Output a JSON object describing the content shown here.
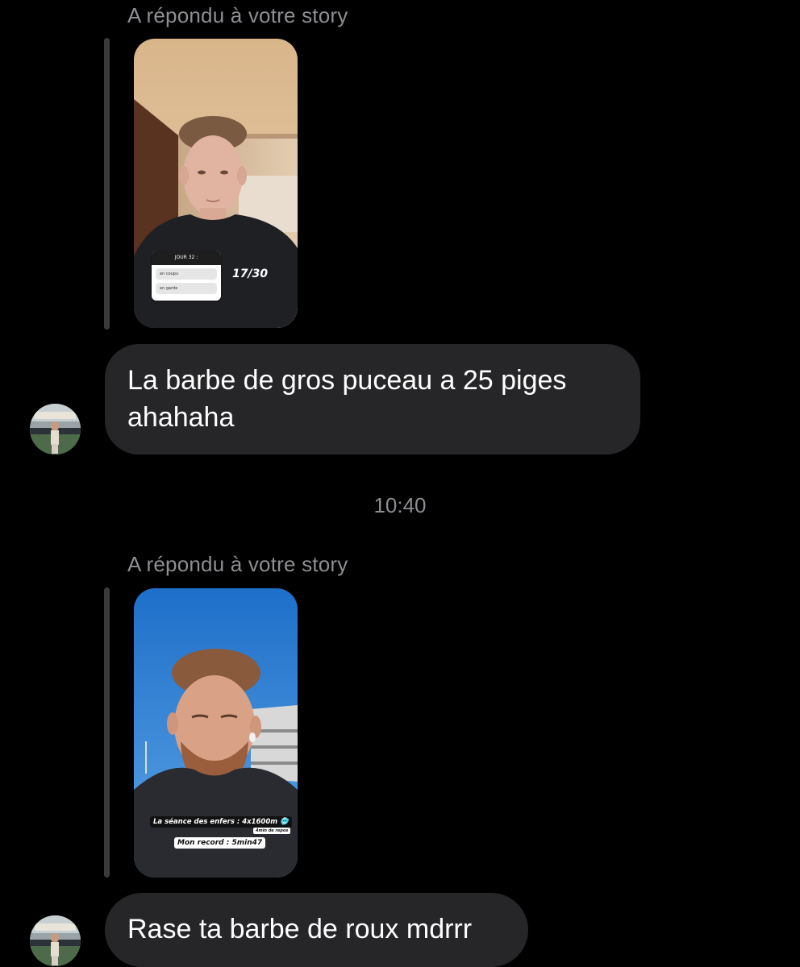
{
  "messages": [
    {
      "reply_label": "A répondu à votre story",
      "story_stickers": {
        "poll_title": "JOUR 32 :",
        "poll_options": [
          "en coupu",
          "en garde"
        ],
        "day_counter": "17/30"
      },
      "text": "La barbe de gros puceau a 25 piges ahahaha"
    },
    {
      "reply_label": "A répondu à votre story",
      "story_stickers": {
        "title": "La séance des enfers : 4x1600m 🥶",
        "rest": "4min de repos",
        "record": "Mon record : 5min47"
      },
      "text": "Rase ta barbe de roux mdrrr"
    }
  ],
  "timestamp": "10:40",
  "colors": {
    "background": "#000000",
    "bubble": "#262628",
    "secondary_text": "#8e8e93",
    "reply_bar": "#3a3a3c"
  }
}
